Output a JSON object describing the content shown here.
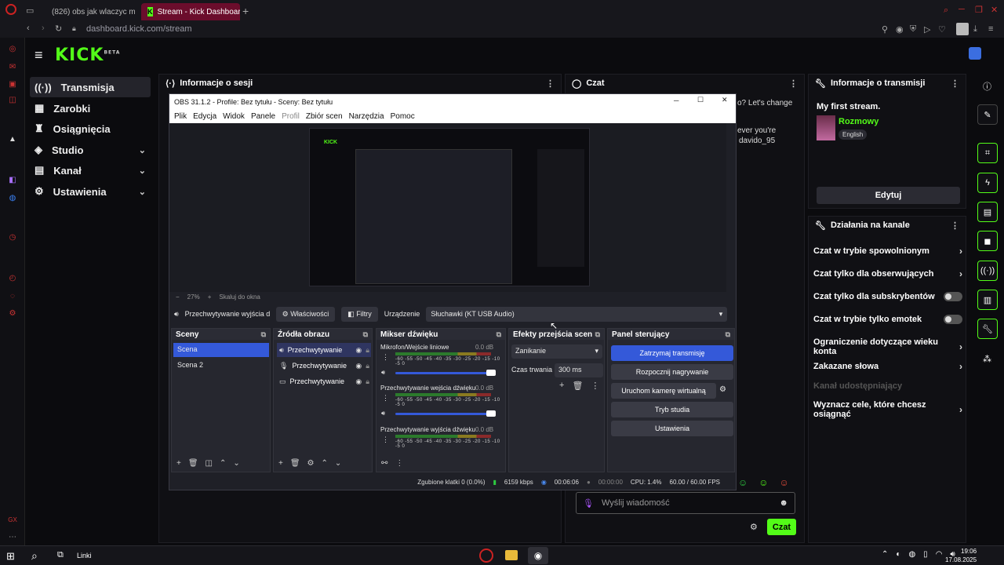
{
  "browser": {
    "tabs": [
      {
        "label": "(826) obs jak wlaczyc m..."
      },
      {
        "label": "Stream - Kick Dashboard"
      }
    ],
    "url": "dashboard.kick.com/stream",
    "new_tab": "+"
  },
  "kick": {
    "logo": "KICK",
    "logo_badge": "BETA",
    "nav": [
      {
        "label": "Transmisja"
      },
      {
        "label": "Zarobki"
      },
      {
        "label": "Osiągnięcia"
      },
      {
        "label": "Studio"
      },
      {
        "label": "Kanał"
      },
      {
        "label": "Ustawienia"
      }
    ],
    "session_panel": {
      "title": "Informacje o sesji"
    },
    "chat_panel": {
      "title": "Czat",
      "lines": [
        "o? Let's change",
        "ever you're",
        "davido_95"
      ],
      "input_placeholder": "Wyślij wiadomość",
      "send_label": "Czat"
    },
    "stream_info": {
      "title": "Informacje o transmisji",
      "stream_title": "My first stream.",
      "category": "Rozmowy",
      "language": "English",
      "edit_label": "Edytuj"
    },
    "channel_actions": {
      "title": "Działania na kanale",
      "items": [
        {
          "label": "Czat w trybie spowolnionym",
          "kind": "arrow"
        },
        {
          "label": "Czat tylko dla obserwujących",
          "kind": "arrow"
        },
        {
          "label": "Czat tylko dla subskrybentów",
          "kind": "toggle"
        },
        {
          "label": "Czat w trybie tylko emotek",
          "kind": "toggle"
        },
        {
          "label": "Ograniczenie dotyczące wieku konta",
          "kind": "arrow"
        },
        {
          "label": "Zakazane słowa",
          "kind": "arrow"
        },
        {
          "label": "Kanał udostępniający",
          "kind": "disabled"
        },
        {
          "label": "Wyznacz cele, które chcesz osiągnąć",
          "kind": "arrow"
        }
      ]
    }
  },
  "obs": {
    "title": "OBS 31.1.2 - Profile: Bez tytułu - Sceny: Bez tytułu",
    "menu": [
      "Plik",
      "Edycja",
      "Widok",
      "Panele",
      "Profil",
      "Zbiór scen",
      "Narzędzia",
      "Pomoc"
    ],
    "zoom": "27%",
    "scale_mode": "Skaluj do okna",
    "source_bar": {
      "source": "Przechwytywanie wyjścia d",
      "properties": "Właściwości",
      "filters": "Filtry",
      "device_label": "Urządzenie",
      "device_value": "Słuchawki (KT USB Audio)"
    },
    "scenes": {
      "title": "Sceny",
      "items": [
        "Scena",
        "Scena 2"
      ]
    },
    "sources": {
      "title": "Źródła obrazu",
      "items": [
        "Przechwytywanie",
        "Przechwytywanie",
        "Przechwytywanie"
      ]
    },
    "mixer": {
      "title": "Mikser dźwięku",
      "scale": "-60 -55 -50 -45 -40 -35 -30 -25 -20 -15 -10 -5 0",
      "channels": [
        {
          "name": "Mikrofon/Wejście liniowe",
          "db": "0.0 dB"
        },
        {
          "name": "Przechwytywanie wejścia dźwięku",
          "db": "0.0 dB"
        },
        {
          "name": "Przechwytywanie wyjścia dźwięku",
          "db": "0.0 dB"
        }
      ]
    },
    "transitions": {
      "title": "Efekty przejścia scen",
      "selected": "Zanikanie",
      "duration_label": "Czas trwania",
      "duration_value": "300 ms"
    },
    "controls": {
      "title": "Panel sterujący",
      "buttons": [
        "Zatrzymaj transmisję",
        "Rozpocznij nagrywanie",
        "Uruchom kamerę wirtualną",
        "Tryb studia",
        "Ustawienia"
      ]
    },
    "status": {
      "dropped": "Zgubione klatki 0 (0.0%)",
      "bitrate": "6159 kbps",
      "stream_time": "00:06:06",
      "rec_time": "00:00:00",
      "cpu": "CPU: 1.4%",
      "fps": "60.00 / 60.00 FPS"
    }
  },
  "taskbar": {
    "links": "Linki",
    "time": "19:06",
    "date": "17.08.2025"
  }
}
